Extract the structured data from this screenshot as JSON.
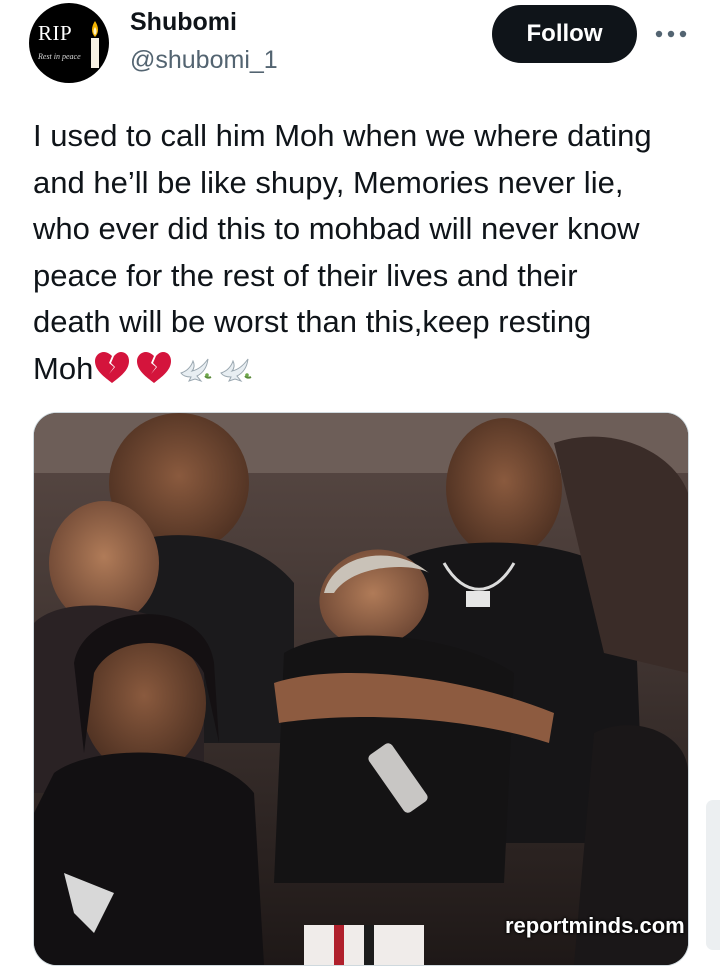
{
  "user": {
    "avatar_text": "RIP",
    "avatar_subtext": "Rest in peace",
    "display_name": "Shubomi",
    "handle": "@shubomi_1"
  },
  "actions": {
    "follow_label": "Follow",
    "more_icon": "more-horizontal-icon"
  },
  "tweet": {
    "text": "I used to call him Moh when we where dating\nand he’ll be like shupy, Memories never lie,\nwho ever did this to mohbad will never know\npeace for the rest of their lives and their\ndeath will be worst than this,keep resting\nMoh",
    "emojis": [
      "broken-heart-icon",
      "broken-heart-icon",
      "dove-icon",
      "dove-icon"
    ]
  },
  "media": {
    "watermark": "reportminds.com"
  },
  "colors": {
    "text": "#0f1419",
    "secondary": "#536471",
    "follow_bg": "#0f1419",
    "follow_text": "#ffffff",
    "broken_heart": "#d4143c"
  }
}
